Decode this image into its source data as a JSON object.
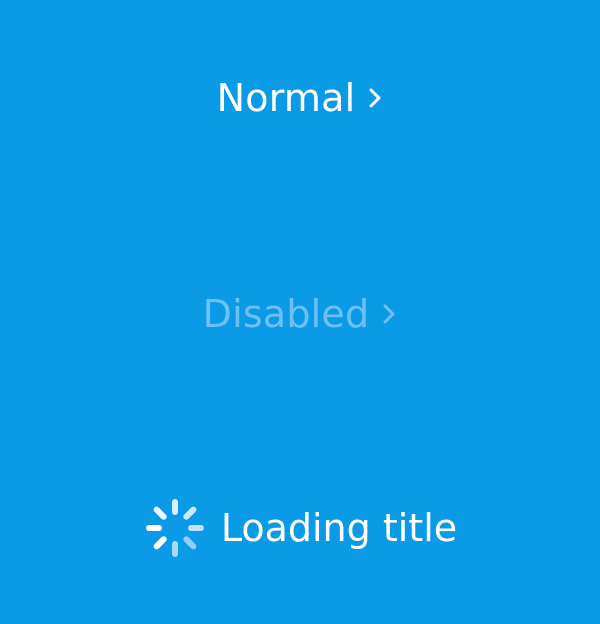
{
  "buttons": {
    "normal": {
      "label": "Normal",
      "state": "enabled",
      "icon": "chevron-right-icon"
    },
    "disabled": {
      "label": "Disabled",
      "state": "disabled",
      "icon": "chevron-right-icon"
    },
    "loading": {
      "label": "Loading title",
      "state": "loading",
      "icon": "spinner-icon"
    }
  },
  "colors": {
    "background": "#0b9ae6",
    "text": "#ffffff",
    "disabled_text": "#6cc1f2",
    "spinner_light": "#d7efff",
    "spinner_dim": "#8fd0f7"
  }
}
